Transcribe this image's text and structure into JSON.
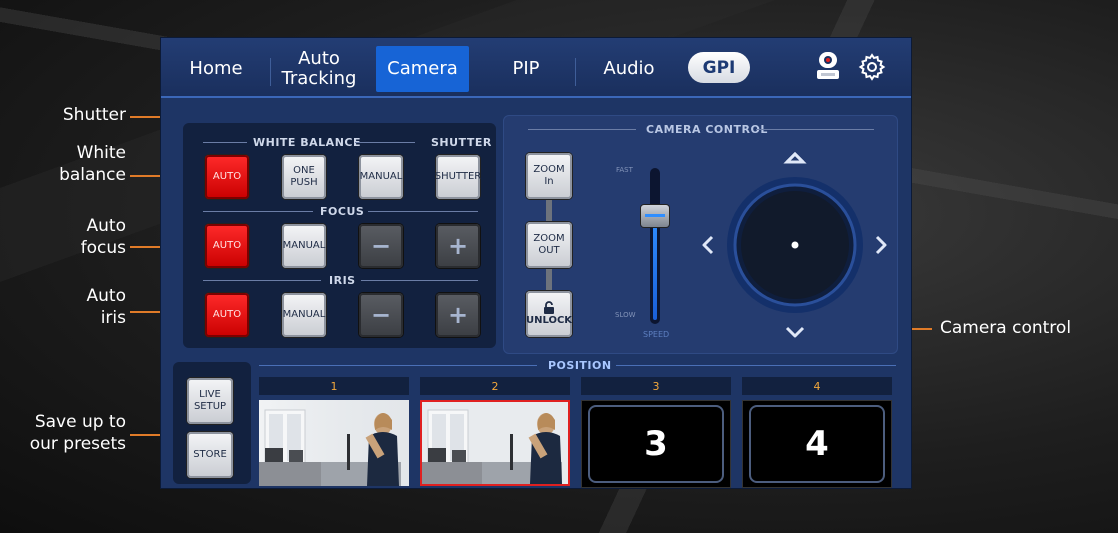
{
  "callouts": {
    "shutter": "Shutter",
    "white_balance": [
      "White",
      "balance"
    ],
    "auto_focus": [
      "Auto",
      "focus"
    ],
    "auto_iris": [
      "Auto",
      "iris"
    ],
    "presets": [
      "Save up to",
      "our presets"
    ],
    "camera_control": "Camera control"
  },
  "nav": {
    "tabs": [
      {
        "label_line1": "Home",
        "label_line2": ""
      },
      {
        "label_line1": "Auto",
        "label_line2": "Tracking"
      },
      {
        "label_line1": "Camera",
        "label_line2": ""
      },
      {
        "label_line1": "PIP",
        "label_line2": ""
      },
      {
        "label_line1": "Audio",
        "label_line2": ""
      }
    ],
    "active_tab": "Camera",
    "gpi_label": "GPI",
    "icons": [
      "ptz-camera-icon",
      "gear-icon"
    ]
  },
  "left_panel": {
    "white_balance_title": "WHITE BALANCE",
    "shutter_title": "SHUTTER",
    "focus_title": "FOCUS",
    "iris_title": "IRIS",
    "wb_auto": "AUTO",
    "wb_one_push": [
      "ONE",
      "PUSH"
    ],
    "wb_manual": "MANUAL",
    "shutter_btn": "SHUTTER",
    "focus_auto": "AUTO",
    "focus_manual": "MANUAL",
    "iris_auto": "AUTO",
    "iris_manual": "MANUAL",
    "minus": "−",
    "plus": "+"
  },
  "camera_control": {
    "title": "CAMERA CONTROL",
    "zoom_in": [
      "ZOOM",
      "In"
    ],
    "zoom_out": [
      "ZOOM",
      "OUT"
    ],
    "unlock": "UNLOCK",
    "speed_fast": "FAST",
    "speed_slow": "SLOW",
    "speed_label": "SPEED",
    "speed_level": 0.7
  },
  "position": {
    "title": "POSITION",
    "live_setup": [
      "LIVE",
      "SETUP"
    ],
    "store": "STORE",
    "presets": [
      {
        "number": "1",
        "content": "photo"
      },
      {
        "number": "2",
        "content": "photo-selected"
      },
      {
        "number": "3",
        "content": "3"
      },
      {
        "number": "4",
        "content": "4"
      }
    ]
  },
  "colors": {
    "accent": "#e07b28",
    "active_tab": "#1764d6",
    "auto_red": "#e00000",
    "app_bg": "#1e3565"
  }
}
